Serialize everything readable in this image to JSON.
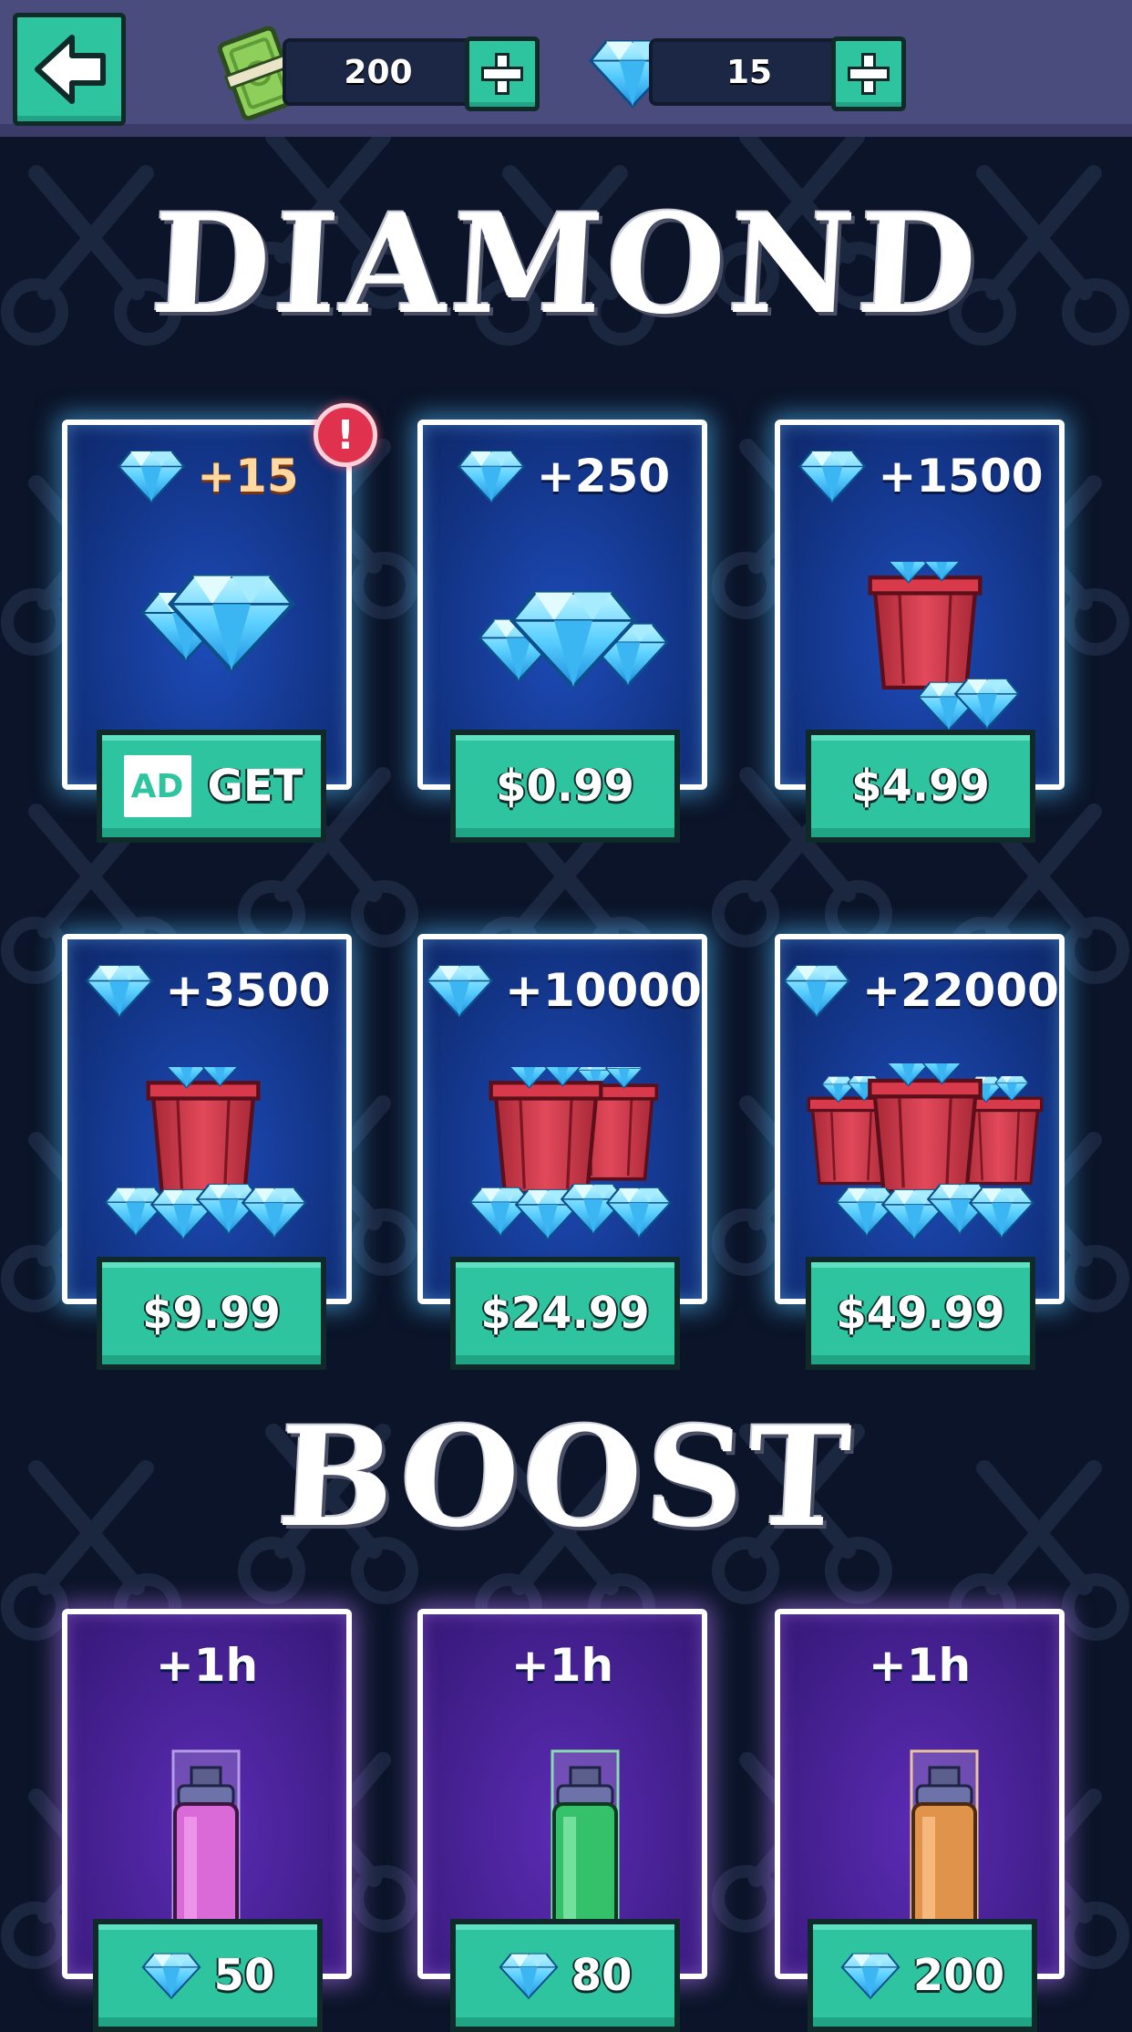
{
  "colors": {
    "background": "#0b1428",
    "topbar": "#4b4c7e",
    "accent_green": "#2ec4a0",
    "diamond_card": "#133588",
    "boost_card": "#44208f",
    "alert_red": "#e0314f"
  },
  "topbar": {
    "back_icon": "back-arrow-icon",
    "cash": {
      "icon": "cash-icon",
      "value": "200",
      "add_icon": "plus-icon"
    },
    "diamonds": {
      "icon": "diamond-icon",
      "value": "15",
      "add_icon": "plus-icon"
    }
  },
  "diamond_section": {
    "title": "DIAMOND",
    "packs": [
      {
        "amount": "+15",
        "button_label": "GET",
        "ad_label": "AD",
        "has_alert": true,
        "alert_label": "!"
      },
      {
        "amount": "+250",
        "button_label": "$0.99"
      },
      {
        "amount": "+1500",
        "button_label": "$4.99"
      },
      {
        "amount": "+3500",
        "button_label": "$9.99"
      },
      {
        "amount": "+10000",
        "button_label": "$24.99"
      },
      {
        "amount": "+22000",
        "button_label": "$49.99"
      }
    ]
  },
  "boost_section": {
    "title": "BOOST",
    "items": [
      {
        "duration": "+1h",
        "price": "50",
        "color": "#d96ad8"
      },
      {
        "duration": "+1h",
        "price": "80",
        "color": "#35c06a"
      },
      {
        "duration": "+1h",
        "price": "200",
        "color": "#e0934a"
      }
    ]
  }
}
